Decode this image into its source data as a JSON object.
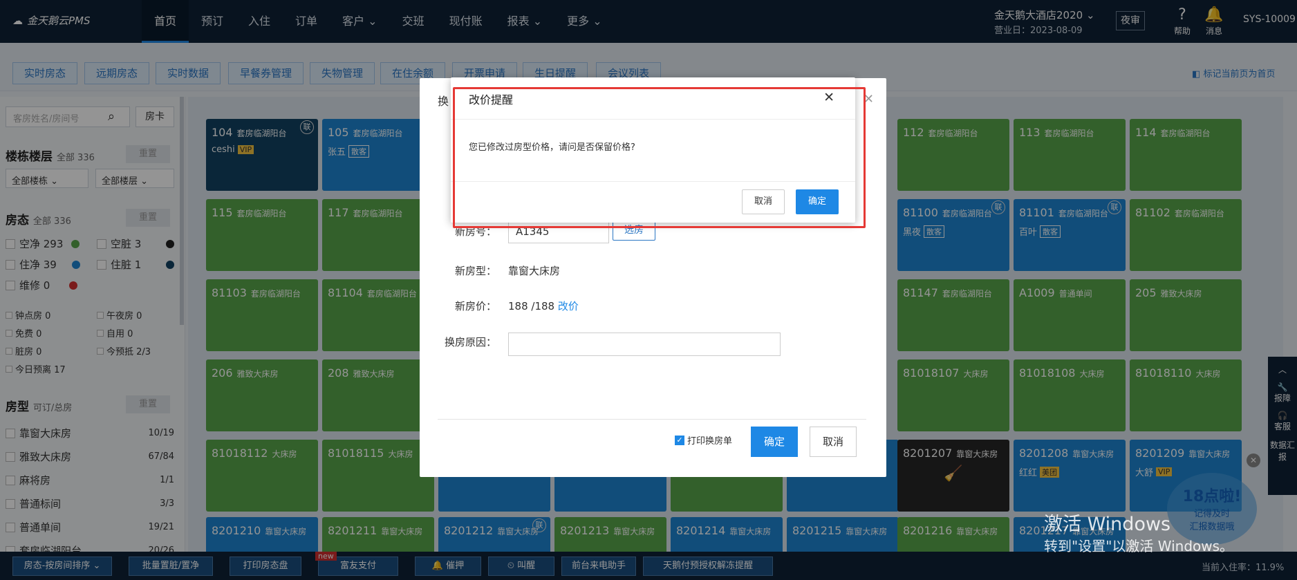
{
  "app": {
    "logo": "金天鹅云PMS",
    "hotel": "金天鹅大酒店2020",
    "biz_date": "营业日：2023-08-09",
    "night_audit": "夜审",
    "help": "帮助",
    "messages": "消息",
    "user": "SYS-10009"
  },
  "nav": [
    "首页",
    "预订",
    "入住",
    "订单",
    "客户",
    "交班",
    "现付账",
    "报表",
    "更多"
  ],
  "tabs": [
    "实时房态",
    "远期房态",
    "实时数据",
    "早餐券管理",
    "失物管理",
    "在住余额",
    "开票申请",
    "生日提醒",
    "会议列表"
  ],
  "pin_label": "标记当前页为首页",
  "sidebar": {
    "search_placeholder": "客房姓名/房间号",
    "card_btn": "房卡",
    "building": {
      "title": "楼栋楼层",
      "sub": "全部 336",
      "reset": "重置",
      "sel1": "全部楼栋",
      "sel2": "全部楼层"
    },
    "status": {
      "title": "房态",
      "sub": "全部 336",
      "reset": "重置",
      "items": [
        {
          "label": "空净 293",
          "color": "#58a64a"
        },
        {
          "label": "空脏 3",
          "color": "#222222"
        },
        {
          "label": "住净 39",
          "color": "#1e86d2"
        },
        {
          "label": "住脏 1",
          "color": "#124263"
        },
        {
          "label": "维修 0",
          "color": "#d32f2f"
        }
      ]
    },
    "flags": [
      "钟点房 0",
      "午夜房 0",
      "免费 0",
      "自用 0",
      "脏房 0",
      "今预抵 2/3",
      "今日预离 17"
    ],
    "roomtype": {
      "title": "房型",
      "sub": "可订/总房",
      "reset": "重置",
      "items": [
        {
          "name": "靠窗大床房",
          "count": "10/19"
        },
        {
          "name": "雅致大床房",
          "count": "67/84"
        },
        {
          "name": "麻将房",
          "count": "1/1"
        },
        {
          "name": "普通标间",
          "count": "3/3"
        },
        {
          "name": "普通单间",
          "count": "19/21"
        },
        {
          "name": "套房临湖阳台",
          "count": "20/26"
        }
      ]
    }
  },
  "rooms": [
    {
      "no": "104",
      "type": "套房临湖阳台",
      "guest": "ceshi",
      "badge": "VIP",
      "lian": "联"
    },
    {
      "no": "105",
      "type": "套房临湖阳台",
      "guest": "张五",
      "badge": "散客"
    },
    {
      "no": "112",
      "type": "套房临湖阳台"
    },
    {
      "no": "113",
      "type": "套房临湖阳台"
    },
    {
      "no": "114",
      "type": "套房临湖阳台"
    },
    {
      "no": "115",
      "type": "套房临湖阳台"
    },
    {
      "no": "117",
      "type": "套房临湖阳台"
    },
    {
      "no": "81100",
      "type": "套房临湖阳台",
      "guest": "黑夜",
      "badge": "散客",
      "lian": "联"
    },
    {
      "no": "81101",
      "type": "套房临湖阳台",
      "guest": "百叶",
      "badge": "散客",
      "lian": "联"
    },
    {
      "no": "81102",
      "type": "套房临湖阳台"
    },
    {
      "no": "81103",
      "type": "套房临湖阳台"
    },
    {
      "no": "81104",
      "type": "套房临湖阳台"
    },
    {
      "no": "81147",
      "type": "套房临湖阳台"
    },
    {
      "no": "A1009",
      "type": "普通单间"
    },
    {
      "no": "205",
      "type": "雅致大床房"
    },
    {
      "no": "206",
      "type": "雅致大床房"
    },
    {
      "no": "208",
      "type": "雅致大床房"
    },
    {
      "no": "81018107",
      "type": "大床房"
    },
    {
      "no": "81018108",
      "type": "大床房"
    },
    {
      "no": "81018110",
      "type": "大床房"
    },
    {
      "no": "81018112",
      "type": "大床房"
    },
    {
      "no": "81018115",
      "type": "大床房"
    },
    {
      "no": "8201207",
      "type": "靠窗大床房"
    },
    {
      "no": "8201208",
      "type": "靠窗大床房",
      "guest": "红红",
      "badge": "美团"
    },
    {
      "no": "8201209",
      "type": "靠窗大床房",
      "guest": "大舒",
      "badge": "VIP"
    },
    {
      "no": "8201210",
      "type": "靠窗大床房"
    },
    {
      "no": "8201211",
      "type": "靠窗大床房"
    },
    {
      "no": "8201212",
      "type": "靠窗大床房",
      "lian": "联"
    },
    {
      "no": "8201213",
      "type": "靠窗大床房"
    },
    {
      "no": "8201214",
      "type": "靠窗大床房"
    },
    {
      "no": "8201215",
      "type": "靠窗大床房"
    },
    {
      "no": "8201216",
      "type": "靠窗大床房"
    },
    {
      "no": "8201217",
      "type": "靠窗大床房"
    }
  ],
  "change_dialog": {
    "title": "换",
    "new_room_label": "新房号：",
    "new_room_value": "A1345",
    "pick_room": "选房",
    "new_type_label": "新房型：",
    "new_type_value": "靠窗大床房",
    "new_price_label": "新房价：",
    "new_price_value": "188  /188",
    "change_price": "改价",
    "reason_label": "换房原因：",
    "print_label": "打印换房单",
    "ok": "确定",
    "cancel": "取消"
  },
  "alert": {
    "title": "改价提醒",
    "message": "您已修改过房型价格，请问是否保留价格?",
    "cancel": "取消",
    "ok": "确定"
  },
  "bottom": {
    "sort": "房态-按房间排序",
    "batch": "批量置脏/置净",
    "print": "打印房态盘",
    "pay": "富友支付",
    "new": "new",
    "urge": "催押",
    "wake": "叫醒",
    "phone": "前台来电助手",
    "unfreeze": "天鹅付预授权解冻提醒",
    "occupancy": "当前入住率：11.9%"
  },
  "right_rail": [
    "报障",
    "客服",
    "数据汇报"
  ],
  "promo": {
    "title": "18点啦!",
    "line1": "记得及时",
    "line2": "汇报数据哦"
  },
  "watermark": {
    "line1": "激活 Windows",
    "line2": "转到\"设置\"以激活 Windows。"
  }
}
